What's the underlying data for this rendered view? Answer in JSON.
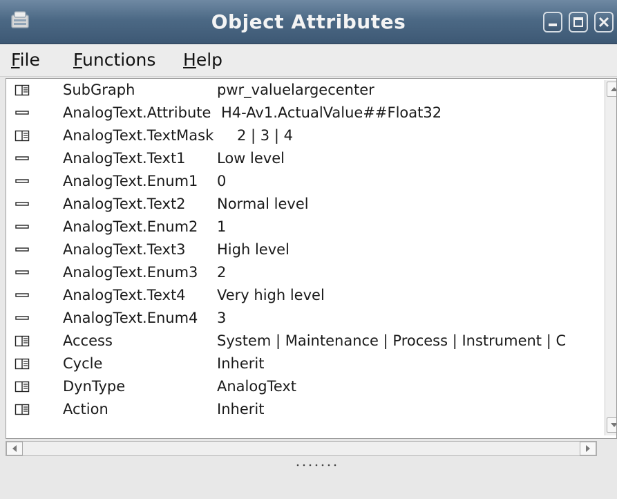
{
  "window": {
    "title": "Object Attributes"
  },
  "menubar": {
    "items": [
      {
        "mnemonic": "F",
        "rest": "ile"
      },
      {
        "mnemonic": "F",
        "rest": "unctions"
      },
      {
        "mnemonic": "H",
        "rest": "elp"
      }
    ]
  },
  "attributes": [
    {
      "icon": "folder-icon",
      "name": "SubGraph",
      "value": "pwr_valuelargecenter"
    },
    {
      "icon": "attribute-icon",
      "name": "AnalogText.Attribute",
      "value": "H4-Av1.ActualValue##Float32"
    },
    {
      "icon": "folder-icon",
      "name": "AnalogText.TextMask",
      "value": "2 | 3 | 4"
    },
    {
      "icon": "attribute-icon",
      "name": "AnalogText.Text1",
      "value": "Low level"
    },
    {
      "icon": "attribute-icon",
      "name": "AnalogText.Enum1",
      "value": "0"
    },
    {
      "icon": "attribute-icon",
      "name": "AnalogText.Text2",
      "value": "Normal level"
    },
    {
      "icon": "attribute-icon",
      "name": "AnalogText.Enum2",
      "value": "1"
    },
    {
      "icon": "attribute-icon",
      "name": "AnalogText.Text3",
      "value": "High level"
    },
    {
      "icon": "attribute-icon",
      "name": "AnalogText.Enum3",
      "value": "2"
    },
    {
      "icon": "attribute-icon",
      "name": "AnalogText.Text4",
      "value": "Very high level"
    },
    {
      "icon": "attribute-icon",
      "name": "AnalogText.Enum4",
      "value": "3"
    },
    {
      "icon": "folder-icon",
      "name": "Access",
      "value": "System | Maintenance | Process | Instrument | C"
    },
    {
      "icon": "folder-icon",
      "name": "Cycle",
      "value": "Inherit"
    },
    {
      "icon": "folder-icon",
      "name": "DynType",
      "value": "AnalogText"
    },
    {
      "icon": "folder-icon",
      "name": "Action",
      "value": "Inherit"
    }
  ]
}
